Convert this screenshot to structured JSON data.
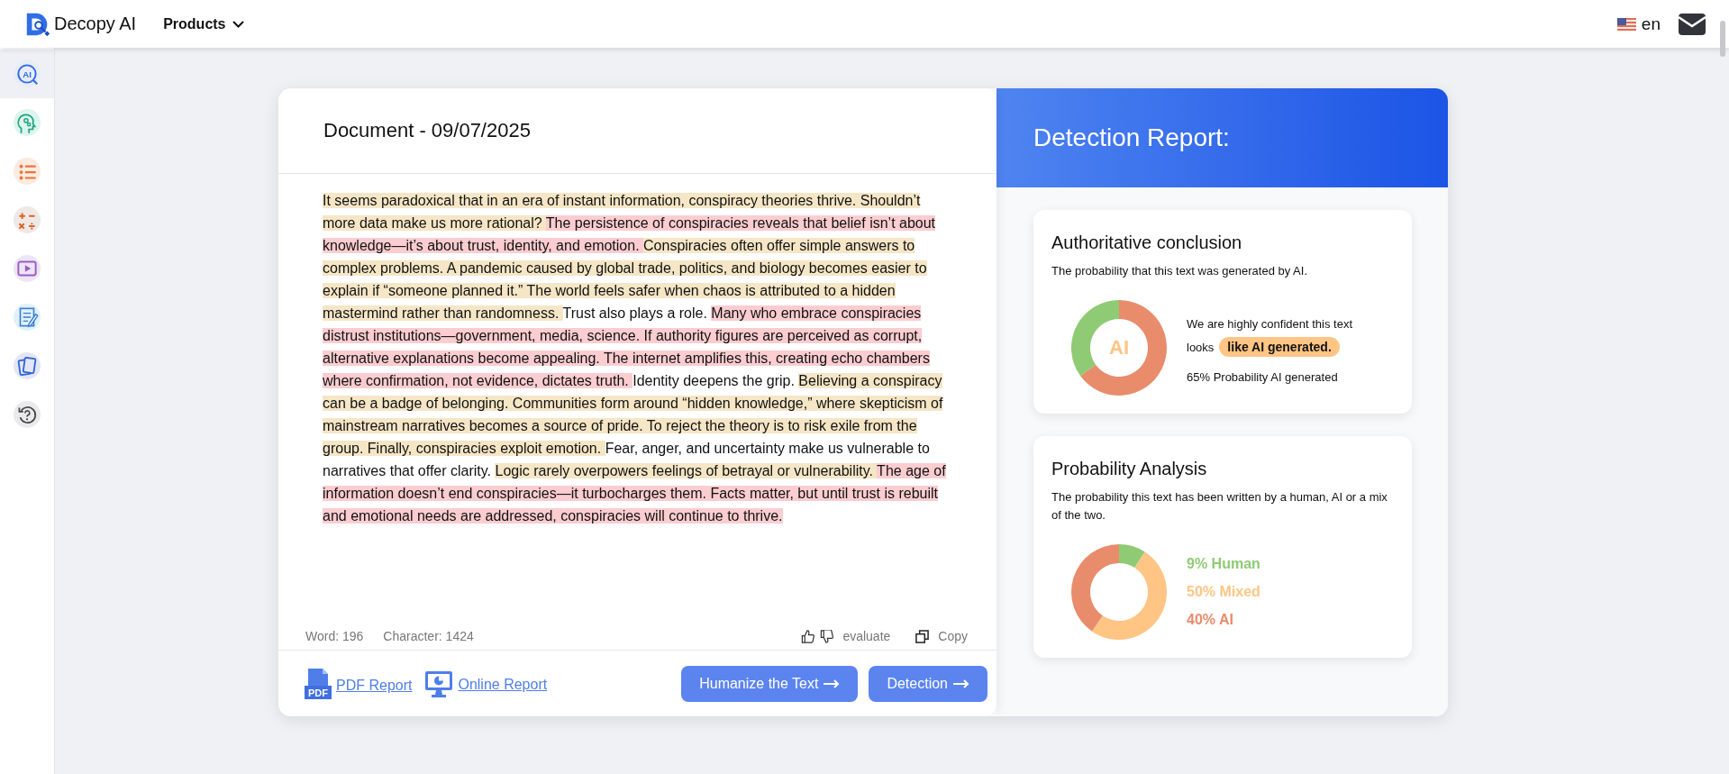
{
  "header": {
    "logo": "Decopy AI",
    "nav": [
      {
        "label": "Products"
      }
    ],
    "language": "en"
  },
  "sidebar": {
    "items": [
      {
        "kind": "ai-search",
        "selected": true,
        "glyph": "AI"
      },
      {
        "kind": "head",
        "selected": false
      },
      {
        "kind": "list",
        "selected": false
      },
      {
        "kind": "math",
        "selected": false
      },
      {
        "kind": "video",
        "selected": false
      },
      {
        "kind": "notebook",
        "selected": false
      },
      {
        "kind": "cards",
        "selected": false
      },
      {
        "kind": "help",
        "selected": false
      }
    ]
  },
  "document": {
    "title": "Document - 09/07/2025",
    "segments": [
      {
        "kind": "mixed",
        "text": "It seems paradoxical that in an era of instant information, conspiracy theories thrive. Shouldn’t more data make us more rational? "
      },
      {
        "kind": "ai",
        "text": "The persistence of conspiracies reveals that belief isn’t about knowledge—it’s about trust, identity, and emotion. "
      },
      {
        "kind": "mixed",
        "text": "Conspiracies often offer simple answers to complex problems. A pandemic caused by global trade, politics, and biology becomes easier to explain if “someone planned it.” The world feels safer when chaos is attributed to a hidden mastermind rather than randomness. "
      },
      {
        "kind": "human",
        "text": "Trust also plays a role. "
      },
      {
        "kind": "ai",
        "text": "Many who embrace conspiracies distrust institutions—government, media, science. If authority figures are perceived as corrupt, alternative explanations become appealing. The internet amplifies this, creating echo chambers where confirmation, not evidence, dictates truth. "
      },
      {
        "kind": "human",
        "text": "Identity deepens the grip. "
      },
      {
        "kind": "mixed",
        "text": "Believing a conspiracy can be a badge of belonging. Communities form around “hidden knowledge,” where skepticism of mainstream narratives becomes a source of pride. To reject the theory is to risk exile from the group. Finally, conspiracies exploit emotion. "
      },
      {
        "kind": "human",
        "text": "Fear, anger, and uncertainty make us vulnerable to narratives that offer clarity. "
      },
      {
        "kind": "mixed",
        "text": "Logic rarely overpowers feelings of betrayal or vulnerability. "
      },
      {
        "kind": "ai",
        "text": "The age of information doesn’t end conspiracies—it turbocharges them. Facts matter, but until trust is rebuilt and emotional needs are addressed, conspiracies will continue to thrive."
      }
    ],
    "word_count": "Word: 196",
    "char_count": "Character: 1424",
    "evaluate": "evaluate",
    "copy": "Copy",
    "links": [
      {
        "kind": "pdf",
        "label": "PDF Report",
        "glyph": "PDF"
      },
      {
        "kind": "monitor",
        "label": "Online Report"
      }
    ],
    "buttons": [
      {
        "label": "Humanize the Text"
      },
      {
        "label": "Detection"
      }
    ]
  },
  "report": {
    "title": "Detection Report:",
    "conclusion": {
      "title": "Authoritative conclusion",
      "description": "The probability that this text was generated by AI.",
      "meter_label": "AI",
      "slices": [
        {
          "color": "#e98c6b"
        },
        {
          "color": "#8fcb74"
        }
      ],
      "chart_data": {
        "type": "donut",
        "values": [
          65,
          35
        ]
      },
      "verdict_prefix": "We are highly confident this text looks",
      "verdict_badge": "like AI generated.",
      "probability": "65% Probability AI generated"
    },
    "analysis": {
      "title": "Probability Analysis",
      "description": "The probability this text has been written by a human, AI or a mix of the two.",
      "slices": [
        {
          "color": "#8fcb74"
        },
        {
          "color": "#ffc585"
        },
        {
          "color": "#e98c6b"
        }
      ],
      "chart_data": {
        "type": "donut",
        "categories": [
          "9% Human",
          "50% Mixed",
          "40% AI"
        ],
        "values": [
          9,
          50,
          40
        ]
      }
    }
  }
}
